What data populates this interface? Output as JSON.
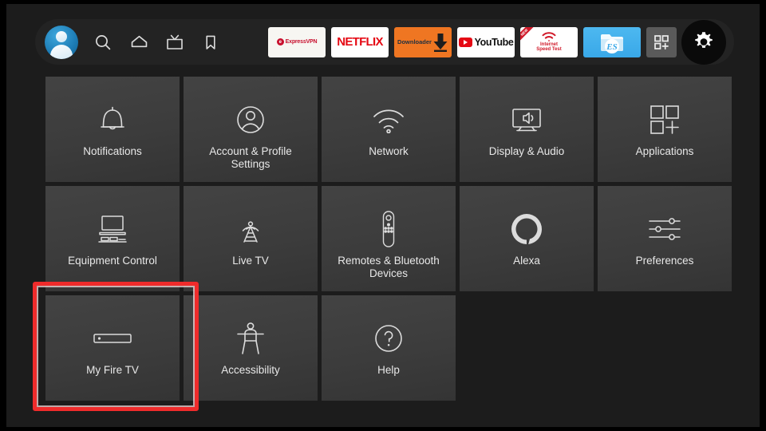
{
  "topbar": {
    "profile": {
      "name": "profile-avatar",
      "label": "Profile"
    },
    "nav_items": [
      {
        "icon": "search-icon",
        "label": "Search"
      },
      {
        "icon": "home-icon",
        "label": "Home"
      },
      {
        "icon": "live-tv-icon",
        "label": "Live TV"
      },
      {
        "icon": "bookmark-icon",
        "label": "Watchlist"
      }
    ],
    "apps": [
      {
        "id": "expressvpn",
        "label": "ExpressVPN"
      },
      {
        "id": "netflix",
        "label": "NETFLIX"
      },
      {
        "id": "downloader",
        "label": "Downloader"
      },
      {
        "id": "youtube",
        "label": "YouTube"
      },
      {
        "id": "speedtest",
        "label_line1": "Internet",
        "label_line2": "Speed Test",
        "ribbon": "NEW"
      },
      {
        "id": "esfile",
        "label": "ES File Explorer"
      }
    ],
    "apps_grid_button": {
      "icon": "apps-grid-plus-icon",
      "label": "Apps"
    },
    "settings_button": {
      "icon": "gear-icon",
      "label": "Settings",
      "selected": true
    }
  },
  "grid": {
    "rows": [
      [
        {
          "icon": "bell-icon",
          "label": "Notifications"
        },
        {
          "icon": "account-person-icon",
          "label": "Account & Profile Settings"
        },
        {
          "icon": "wifi-icon",
          "label": "Network"
        },
        {
          "icon": "display-audio-icon",
          "label": "Display & Audio"
        },
        {
          "icon": "applications-grid-icon",
          "label": "Applications"
        }
      ],
      [
        {
          "icon": "equipment-control-icon",
          "label": "Equipment Control"
        },
        {
          "icon": "broadcast-tower-icon",
          "label": "Live TV"
        },
        {
          "icon": "remote-control-icon",
          "label": "Remotes & Bluetooth Devices"
        },
        {
          "icon": "alexa-ring-icon",
          "label": "Alexa"
        },
        {
          "icon": "sliders-icon",
          "label": "Preferences"
        }
      ],
      [
        {
          "icon": "fire-tv-stick-icon",
          "label": "My Fire TV",
          "highlighted": true
        },
        {
          "icon": "accessibility-icon",
          "label": "Accessibility"
        },
        {
          "icon": "help-question-icon",
          "label": "Help"
        }
      ]
    ]
  },
  "colors": {
    "background": "#1c1c1c",
    "tile": "#3c3c3c",
    "topbar": "#232323",
    "highlight": "#ef2b2b",
    "text": "#e8e8e8",
    "netflix_red": "#e50914",
    "downloader_orange": "#ef7622",
    "esfile_blue": "#39a8e8"
  }
}
